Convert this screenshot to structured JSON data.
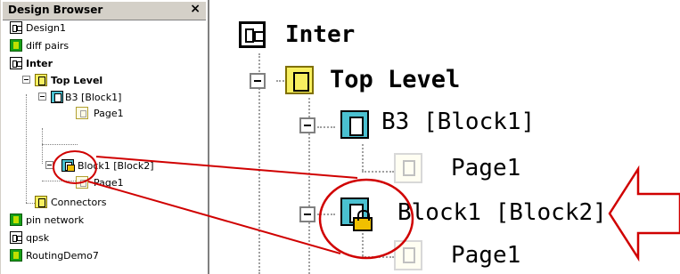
{
  "panel": {
    "title": "Design Browser",
    "close_glyph": "×",
    "items": [
      {
        "label": "Design1",
        "icon": "design-icon"
      },
      {
        "label": "diff pairs",
        "icon": "schematic-icon"
      },
      {
        "label": "Inter",
        "icon": "design-icon",
        "bold": true
      },
      {
        "label": "Top Level",
        "icon": "top-level-icon",
        "bold": true
      },
      {
        "label": "B3 [Block1]",
        "icon": "block-icon"
      },
      {
        "label": "Page1",
        "icon": "page-icon"
      },
      {
        "label": "Block1 [Block2]",
        "icon": "locked-block-icon"
      },
      {
        "label": "Page1",
        "icon": "page-icon"
      },
      {
        "label": "Connectors",
        "icon": "top-level-icon"
      },
      {
        "label": "pin network",
        "icon": "schematic-icon"
      },
      {
        "label": "qpsk",
        "icon": "design-icon"
      },
      {
        "label": "RoutingDemo7",
        "icon": "schematic-icon"
      }
    ]
  },
  "zoom": {
    "items": [
      {
        "label": "Inter"
      },
      {
        "label": "Top Level"
      },
      {
        "label": "B3 [Block1]"
      },
      {
        "label": "Page1"
      },
      {
        "label": "Block1 [Block2]"
      },
      {
        "label": "Page1"
      }
    ]
  },
  "colors": {
    "annotation": "#d00000",
    "callout_arrow": "#d00000",
    "panel_header": "#d4d0c8"
  }
}
